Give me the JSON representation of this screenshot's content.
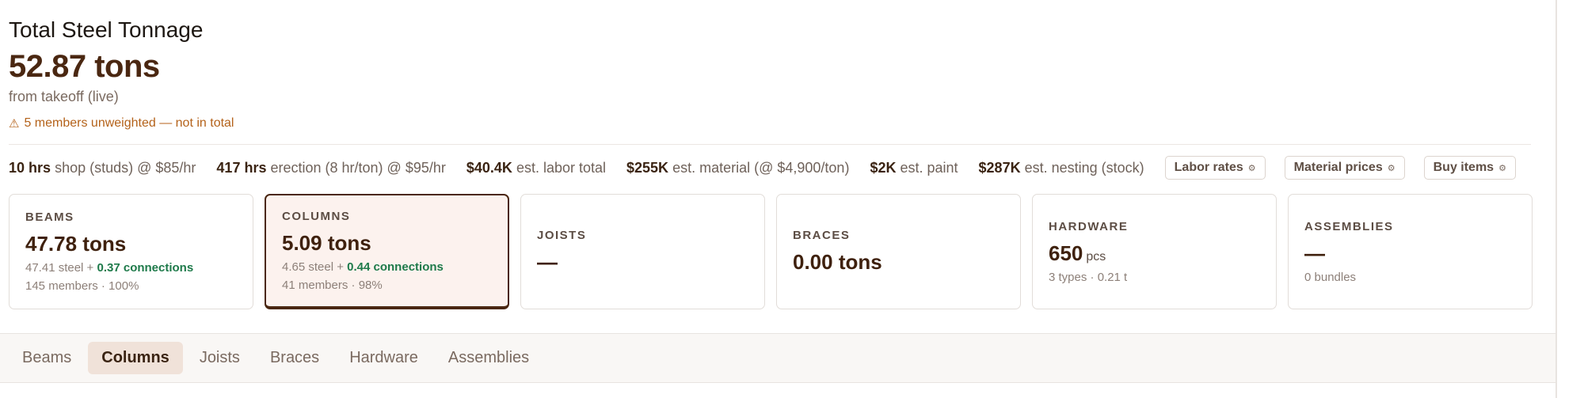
{
  "header": {
    "title": "Total Steel Tonnage",
    "total": "52.87 tons",
    "source": "from takeoff (live)",
    "warning_icon": "warning-triangle-icon",
    "warning_symbol": "⚠",
    "warning": "5 members unweighted — not in total"
  },
  "costs": [
    {
      "value": "10 hrs",
      "label": "shop (studs) @ $85/hr"
    },
    {
      "value": "417 hrs",
      "label": "erection (8 hr/ton) @ $95/hr"
    },
    {
      "value": "$40.4K",
      "label": "est. labor total"
    },
    {
      "value": "$255K",
      "label": "est. material (@ $4,900/ton)"
    },
    {
      "value": "$2K",
      "label": "est. paint"
    },
    {
      "value": "$287K",
      "label": "est. nesting (stock)"
    }
  ],
  "buttons": {
    "labor_rates": "Labor rates",
    "material_prices": "Material prices",
    "buy_items": "Buy items",
    "gear_symbol": "⚙"
  },
  "cards": {
    "beams": {
      "label": "BEAMS",
      "value": "47.78 tons",
      "steel": "47.41 steel + ",
      "connections": "0.37 connections",
      "meta": "145 members · 100%"
    },
    "columns": {
      "label": "COLUMNS",
      "value": "5.09 tons",
      "steel": "4.65 steel + ",
      "connections": "0.44 connections",
      "meta": "41 members · 98%"
    },
    "joists": {
      "label": "JOISTS",
      "value": "—"
    },
    "braces": {
      "label": "BRACES",
      "value": "0.00 tons"
    },
    "hardware": {
      "label": "HARDWARE",
      "value": "650",
      "unit": "pcs",
      "meta": "3 types · 0.21 t"
    },
    "assemblies": {
      "label": "ASSEMBLIES",
      "value": "—",
      "meta": "0 bundles"
    }
  },
  "tabs": [
    "Beams",
    "Columns",
    "Joists",
    "Braces",
    "Hardware",
    "Assemblies"
  ],
  "active_tab": "Columns",
  "colors": {
    "accent": "#4a2711",
    "warning": "#b4621a",
    "connections": "#1e7a4a",
    "active_tab_bg": "#f0e2d9"
  }
}
